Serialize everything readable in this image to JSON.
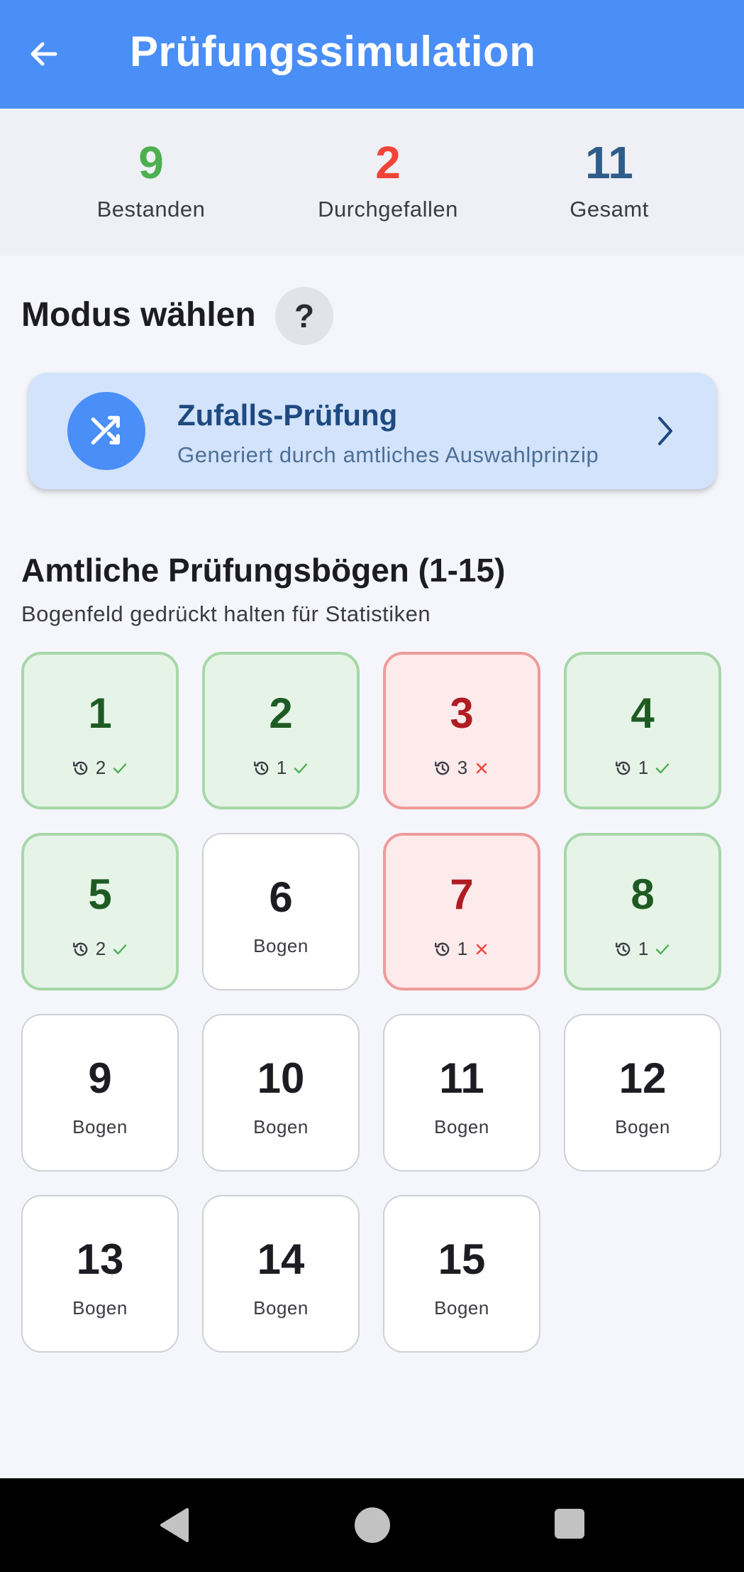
{
  "app_bar": {
    "title": "Prüfungssimulation",
    "back_icon": "arrow-left-icon"
  },
  "stats": [
    {
      "value": "9",
      "label": "Bestanden",
      "color": "#4caf50"
    },
    {
      "value": "2",
      "label": "Durchgefallen",
      "color": "#f0443a"
    },
    {
      "value": "11",
      "label": "Gesamt",
      "color": "#2e5d8a"
    }
  ],
  "mode": {
    "title": "Modus wählen",
    "help_label": "?",
    "random": {
      "title": "Zufalls-Prüfung",
      "subtitle": "Generiert durch amtliches Auswahlprinzip",
      "icon": "shuffle-icon",
      "chevron": "chevron-right-icon"
    }
  },
  "sheets": {
    "title": "Amtliche Prüfungsbögen (1-15)",
    "hint": "Bogenfeld gedrückt halten für Statistiken",
    "items": [
      {
        "number": "1",
        "status": "pass",
        "attempts": "2",
        "label": ""
      },
      {
        "number": "2",
        "status": "pass",
        "attempts": "1",
        "label": ""
      },
      {
        "number": "3",
        "status": "fail",
        "attempts": "3",
        "label": ""
      },
      {
        "number": "4",
        "status": "pass",
        "attempts": "1",
        "label": ""
      },
      {
        "number": "5",
        "status": "pass",
        "attempts": "2",
        "label": ""
      },
      {
        "number": "6",
        "status": "none",
        "attempts": "",
        "label": "Bogen"
      },
      {
        "number": "7",
        "status": "fail",
        "attempts": "1",
        "label": ""
      },
      {
        "number": "8",
        "status": "pass",
        "attempts": "1",
        "label": ""
      },
      {
        "number": "9",
        "status": "none",
        "attempts": "",
        "label": "Bogen"
      },
      {
        "number": "10",
        "status": "none",
        "attempts": "",
        "label": "Bogen"
      },
      {
        "number": "11",
        "status": "none",
        "attempts": "",
        "label": "Bogen"
      },
      {
        "number": "12",
        "status": "none",
        "attempts": "",
        "label": "Bogen"
      },
      {
        "number": "13",
        "status": "none",
        "attempts": "",
        "label": "Bogen"
      },
      {
        "number": "14",
        "status": "none",
        "attempts": "",
        "label": "Bogen"
      },
      {
        "number": "15",
        "status": "none",
        "attempts": "",
        "label": "Bogen"
      }
    ]
  },
  "colors": {
    "primary": "#4a8ef7",
    "pass": "#4caf50",
    "fail": "#f0443a"
  },
  "system_nav": {
    "back": "nav-back-icon",
    "home": "nav-home-icon",
    "recent": "nav-recent-icon"
  }
}
